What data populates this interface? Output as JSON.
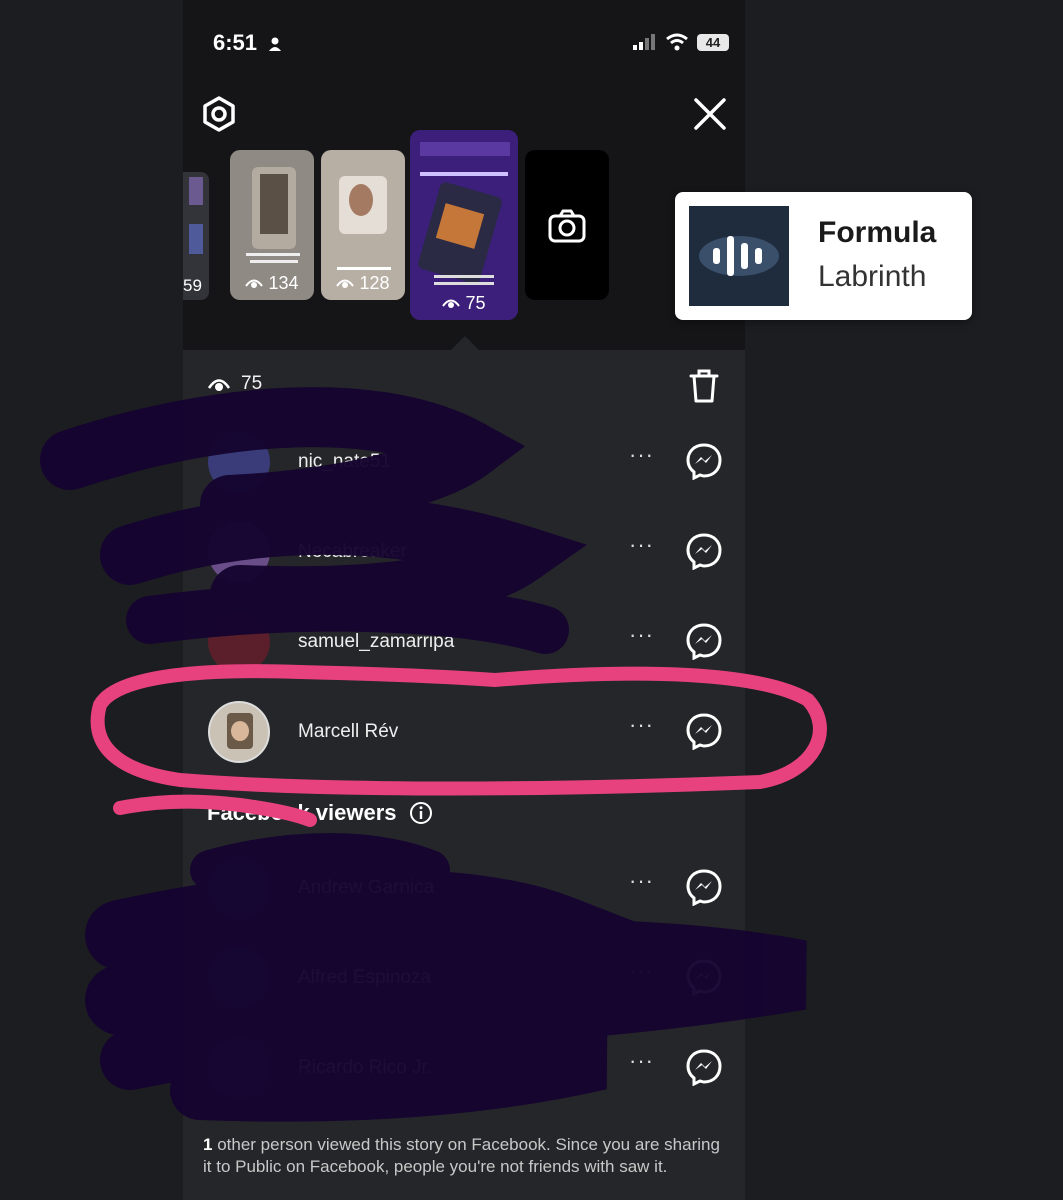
{
  "status_bar": {
    "time": "6:51",
    "battery": "44"
  },
  "stories": {
    "partial_count": "59",
    "items": [
      {
        "views": "134"
      },
      {
        "views": "128"
      },
      {
        "views": "75"
      }
    ]
  },
  "viewer_panel": {
    "view_count": "75",
    "instagram_viewers": [
      {
        "name": "nic_nate51",
        "more": "···"
      },
      {
        "name": "Necabreaker",
        "more": "···"
      },
      {
        "name": "samuel_zamarripa",
        "more": "···"
      },
      {
        "name": "Marcell Rév",
        "more": "···"
      }
    ],
    "facebook_section_title": "Facebook viewers",
    "facebook_viewers": [
      {
        "name": "Andrew Garnica",
        "more": "···"
      },
      {
        "name": "Alfred Espinoza",
        "more": "···"
      },
      {
        "name": "Ricardo Rico Jr.",
        "more": "···"
      }
    ],
    "footer_count": "1",
    "footer_text": " other person viewed this story on Facebook. Since you are sharing it to Public on Facebook, people you're not friends with saw it."
  },
  "song_overlay": {
    "title": "Formula",
    "artist": "Labrinth"
  },
  "colors": {
    "scribble_pink": "#e8427e",
    "scribble_purple": "#150430"
  }
}
